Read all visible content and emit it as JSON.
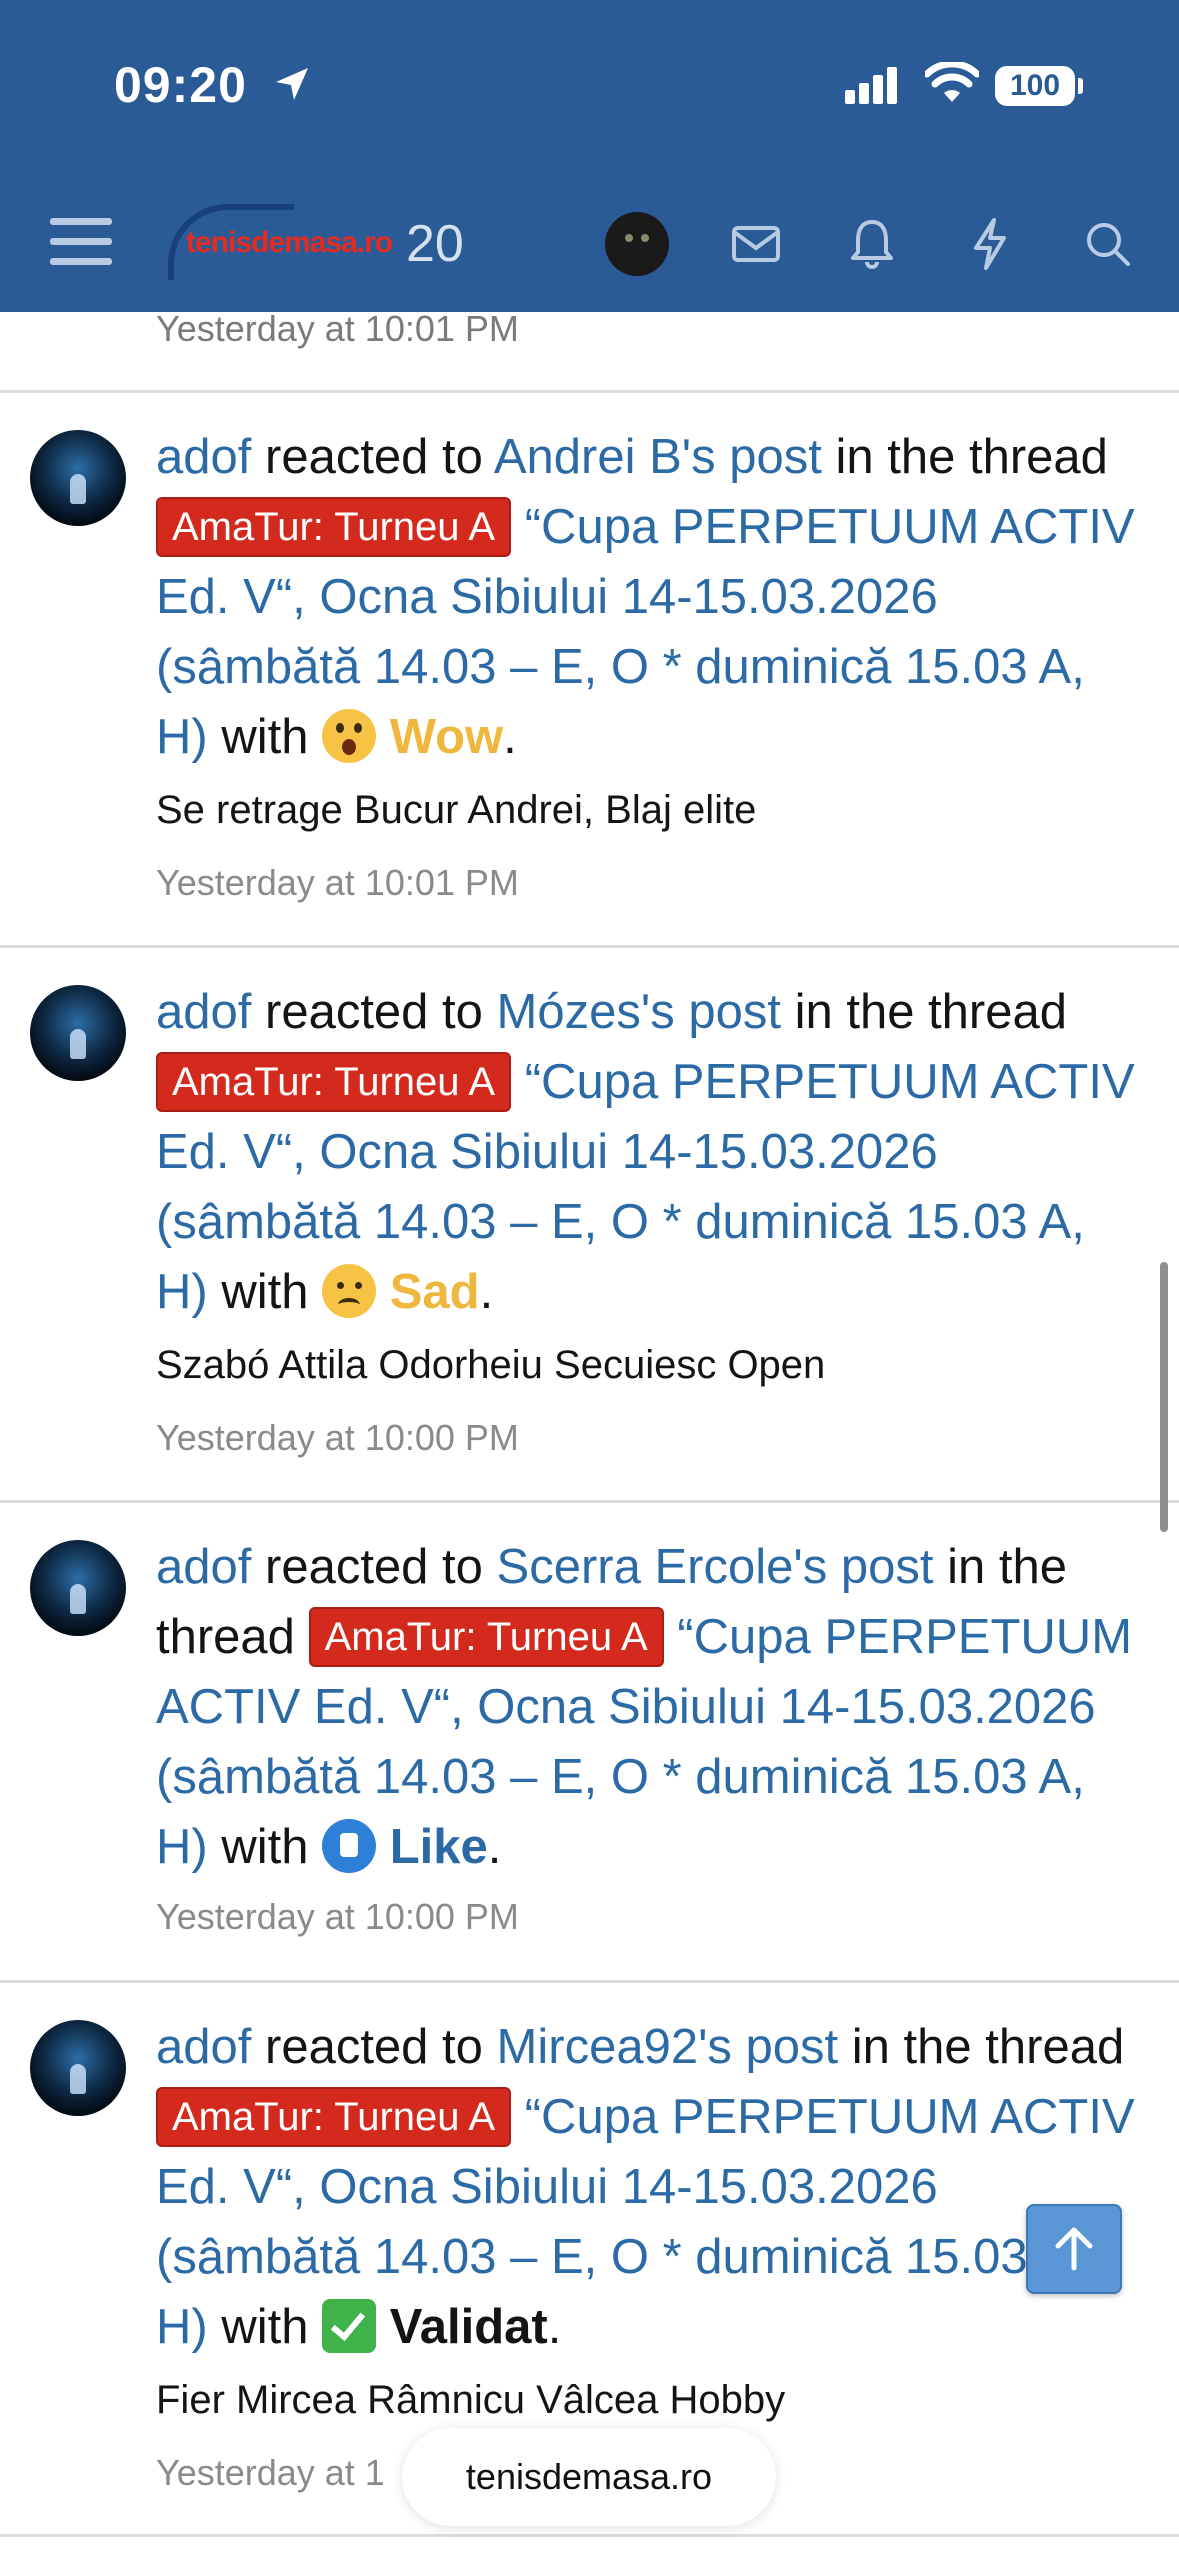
{
  "status": {
    "time": "09:20",
    "battery": "100"
  },
  "header": {
    "logo_text": "tenisdemasa.ro",
    "logo_number": "20"
  },
  "top_timestamp": "Yesterday at 10:01 PM",
  "items": [
    {
      "user": "adof",
      "reacted_to": "reacted to",
      "post_author": "Andrei B's post",
      "in_the_thread": "in the thread",
      "prefix": "AmaTur: Turneu A",
      "thread_title": "“Cupa PERPETUUM ACTIV Ed. V“, Ocna Sibiului 14-15.03.2026 (sâmbătă 14.03 – E, O * duminică 15.03 A, H)",
      "with": "with",
      "reaction": "Wow",
      "snippet": "Se retrage Bucur Andrei, Blaj elite",
      "time": "Yesterday at 10:01 PM"
    },
    {
      "user": "adof",
      "reacted_to": "reacted to",
      "post_author": "Mózes's post",
      "in_the_thread": "in the thread",
      "prefix": "AmaTur: Turneu A",
      "thread_title": "“Cupa PERPETUUM ACTIV Ed. V“, Ocna Sibiului 14-15.03.2026 (sâmbătă 14.03 – E, O * duminică 15.03 A, H)",
      "with": "with",
      "reaction": "Sad",
      "snippet": "Szabó Attila Odorheiu Secuiesc Open",
      "time": "Yesterday at 10:00 PM"
    },
    {
      "user": "adof",
      "reacted_to": "reacted to",
      "post_author": "Scerra Ercole's post",
      "in_the_thread": "in the thread",
      "prefix": "AmaTur: Turneu A",
      "thread_title": "“Cupa PERPETUUM ACTIV Ed. V“, Ocna Sibiului 14-15.03.2026 (sâmbătă 14.03 – E, O * duminică 15.03 A, H)",
      "with": "with",
      "reaction": "Like",
      "snippet": "",
      "time": "Yesterday at 10:00 PM"
    },
    {
      "user": "adof",
      "reacted_to": "reacted to",
      "post_author": "Mircea92's post",
      "in_the_thread": "in the thread",
      "prefix": "AmaTur: Turneu A",
      "thread_title": "“Cupa PERPETUUM ACTIV Ed. V“, Ocna Sibiului 14-15.03.2026 (sâmbătă 14.03 – E, O * duminică 15.03 A, H)",
      "with": "with",
      "reaction": "Validat",
      "snippet": "Fier Mircea Râmnicu Vâlcea Hobby",
      "time": "Yesterday at 1"
    }
  ],
  "url_bar": "tenisdemasa.ro",
  "colors": {
    "header": "#2b5b96",
    "link": "#2c6aa6",
    "prefix_bg": "#d42a1e",
    "wow_sad": "#f0b73e"
  }
}
